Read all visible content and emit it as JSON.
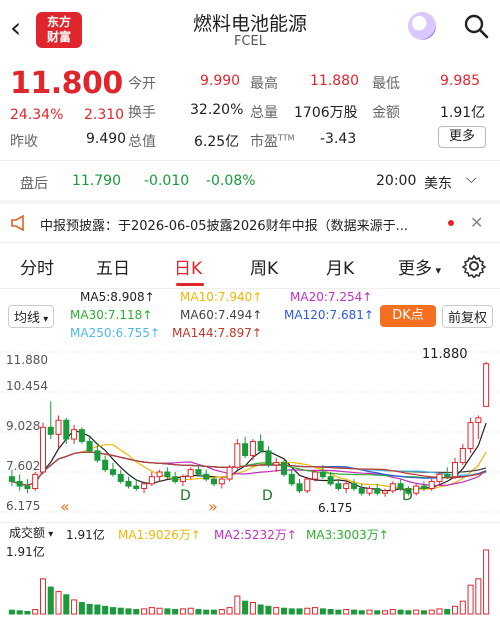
{
  "header": {
    "logo": [
      "东方",
      "财富"
    ],
    "title": "燃料电池能源",
    "ticker": "FCEL"
  },
  "quote": {
    "price": "11.800",
    "change_pct": "24.34%",
    "change_abs": "2.310",
    "prev_close_label": "昨收",
    "prev_close": "9.490",
    "open_label": "今开",
    "open": "9.990",
    "turnover_label": "换手",
    "turnover": "32.20%",
    "mktcap_label": "总值",
    "mktcap": "6.25亿",
    "high_label": "最高",
    "high": "11.880",
    "volume_label": "总量",
    "volume": "1706万股",
    "pe_label": "市盈",
    "pe_sup": "TTM",
    "pe": "-3.43",
    "low_label": "最低",
    "low": "9.985",
    "amount_label": "金额",
    "amount": "1.91亿",
    "more_label": "更多"
  },
  "after_hours": {
    "label": "盘后",
    "price": "11.790",
    "change": "-0.010",
    "change_pct": "-0.08%",
    "time": "20:00",
    "zone": "美东"
  },
  "banner": {
    "text": "中报预披露：于2026-06-05披露2026财年中报（数据来源于..."
  },
  "tabs": [
    "分时",
    "五日",
    "日K",
    "周K",
    "月K",
    "更多"
  ],
  "active_tab": 2,
  "ma": {
    "type_label": "均线",
    "ma5": "MA5:8.908↑",
    "ma10": "MA10:7.940↑",
    "ma20": "MA20:7.254↑",
    "ma30": "MA30:7.118↑",
    "ma60": "MA60:7.494↑",
    "ma120": "MA120:7.681↑",
    "ma250": "MA250:6.755↑",
    "ma144": "MA144:7.897↑",
    "dk_label": "DK点",
    "adjust_label": "前复权"
  },
  "colors": {
    "up": "#e0262d",
    "down": "#1a9a3a",
    "ma5": "#222222",
    "ma10": "#f2b705",
    "ma20": "#c030c0",
    "ma30": "#2fae2f",
    "ma60": "#444444",
    "ma120": "#2a5bd7",
    "ma250": "#4fb8e8",
    "ma144": "#c0392b"
  },
  "chart_data": {
    "type": "candlestick",
    "y_ticks": [
      "11.880",
      "10.454",
      "9.028",
      "7.602",
      "6.175"
    ],
    "ylim": [
      5.5,
      12.3
    ],
    "high_label": "11.880",
    "low_label": "6.175",
    "ohlc": [
      [
        7.0,
        7.3,
        6.6,
        6.8
      ],
      [
        6.8,
        7.1,
        6.4,
        6.6
      ],
      [
        6.6,
        6.9,
        6.3,
        6.5
      ],
      [
        6.5,
        7.2,
        6.4,
        7.1
      ],
      [
        7.2,
        9.3,
        7.1,
        9.1
      ],
      [
        9.1,
        10.2,
        8.6,
        8.8
      ],
      [
        8.8,
        9.6,
        8.2,
        9.4
      ],
      [
        9.4,
        9.5,
        8.4,
        8.6
      ],
      [
        8.6,
        9.2,
        8.4,
        9.0
      ],
      [
        9.0,
        9.1,
        8.4,
        8.5
      ],
      [
        8.5,
        8.7,
        8.0,
        8.1
      ],
      [
        8.1,
        8.4,
        7.6,
        7.7
      ],
      [
        7.7,
        7.9,
        7.2,
        7.3
      ],
      [
        7.3,
        7.6,
        7.0,
        7.1
      ],
      [
        7.1,
        7.3,
        6.7,
        6.8
      ],
      [
        6.8,
        7.0,
        6.5,
        6.6
      ],
      [
        6.6,
        6.9,
        6.4,
        6.5
      ],
      [
        6.5,
        6.8,
        6.3,
        6.7
      ],
      [
        6.7,
        7.2,
        6.6,
        7.0
      ],
      [
        7.0,
        7.3,
        6.8,
        7.2
      ],
      [
        7.2,
        7.4,
        6.9,
        7.0
      ],
      [
        7.0,
        7.2,
        6.7,
        6.8
      ],
      [
        6.8,
        7.1,
        6.6,
        7.0
      ],
      [
        7.0,
        7.4,
        6.9,
        7.3
      ],
      [
        7.3,
        7.5,
        7.0,
        7.1
      ],
      [
        7.1,
        7.3,
        6.8,
        6.9
      ],
      [
        6.9,
        7.0,
        6.6,
        6.7
      ],
      [
        6.7,
        7.0,
        6.5,
        6.9
      ],
      [
        6.9,
        7.5,
        6.8,
        7.4
      ],
      [
        7.4,
        8.6,
        7.3,
        8.4
      ],
      [
        8.4,
        8.7,
        7.8,
        7.9
      ],
      [
        7.9,
        8.6,
        7.7,
        8.5
      ],
      [
        8.5,
        8.8,
        8.0,
        8.1
      ],
      [
        8.1,
        8.3,
        7.4,
        7.5
      ],
      [
        7.5,
        7.8,
        7.2,
        7.6
      ],
      [
        7.6,
        7.7,
        7.0,
        7.1
      ],
      [
        7.1,
        7.3,
        6.6,
        6.7
      ],
      [
        6.7,
        6.9,
        6.3,
        6.4
      ],
      [
        6.4,
        7.0,
        6.3,
        6.9
      ],
      [
        6.9,
        7.3,
        6.8,
        7.2
      ],
      [
        7.2,
        7.5,
        6.9,
        7.0
      ],
      [
        7.0,
        7.2,
        6.6,
        6.7
      ],
      [
        6.7,
        6.9,
        6.4,
        6.5
      ],
      [
        6.5,
        6.8,
        6.3,
        6.7
      ],
      [
        6.7,
        6.9,
        6.4,
        6.5
      ],
      [
        6.5,
        6.7,
        6.2,
        6.3
      ],
      [
        6.3,
        6.6,
        6.2,
        6.5
      ],
      [
        6.5,
        6.7,
        6.2,
        6.3
      ],
      [
        6.3,
        6.5,
        6.15,
        6.4
      ],
      [
        6.4,
        6.8,
        6.3,
        6.7
      ],
      [
        6.7,
        6.9,
        6.4,
        6.5
      ],
      [
        6.5,
        6.6,
        6.2,
        6.3
      ],
      [
        6.3,
        6.7,
        6.2,
        6.6
      ],
      [
        6.6,
        6.8,
        6.4,
        6.5
      ],
      [
        6.5,
        6.9,
        6.4,
        6.8
      ],
      [
        6.8,
        7.2,
        6.7,
        7.1
      ],
      [
        7.1,
        7.4,
        6.9,
        7.0
      ],
      [
        7.0,
        7.8,
        6.9,
        7.6
      ],
      [
        7.6,
        8.4,
        7.5,
        8.2
      ],
      [
        8.2,
        9.5,
        8.0,
        9.3
      ],
      [
        9.3,
        9.6,
        8.6,
        9.5
      ],
      [
        9.99,
        11.88,
        9.985,
        11.8
      ]
    ],
    "volume_max_label": "1.91亿",
    "volume_header": {
      "label": "成交额",
      "value": "1.91亿",
      "ma1": "MA1:9026万↑",
      "ma2": "MA2:5232万↑",
      "ma3": "MA3:3003万↑"
    },
    "volumes": [
      0.06,
      0.05,
      0.04,
      0.07,
      0.55,
      0.42,
      0.35,
      0.3,
      0.22,
      0.18,
      0.15,
      0.14,
      0.12,
      0.1,
      0.09,
      0.08,
      0.07,
      0.08,
      0.1,
      0.09,
      0.08,
      0.07,
      0.08,
      0.09,
      0.07,
      0.06,
      0.06,
      0.07,
      0.1,
      0.28,
      0.2,
      0.18,
      0.14,
      0.12,
      0.1,
      0.09,
      0.08,
      0.08,
      0.09,
      0.1,
      0.08,
      0.07,
      0.06,
      0.07,
      0.06,
      0.05,
      0.06,
      0.05,
      0.05,
      0.07,
      0.06,
      0.05,
      0.06,
      0.05,
      0.06,
      0.08,
      0.07,
      0.12,
      0.2,
      0.45,
      0.55,
      1.0
    ]
  }
}
